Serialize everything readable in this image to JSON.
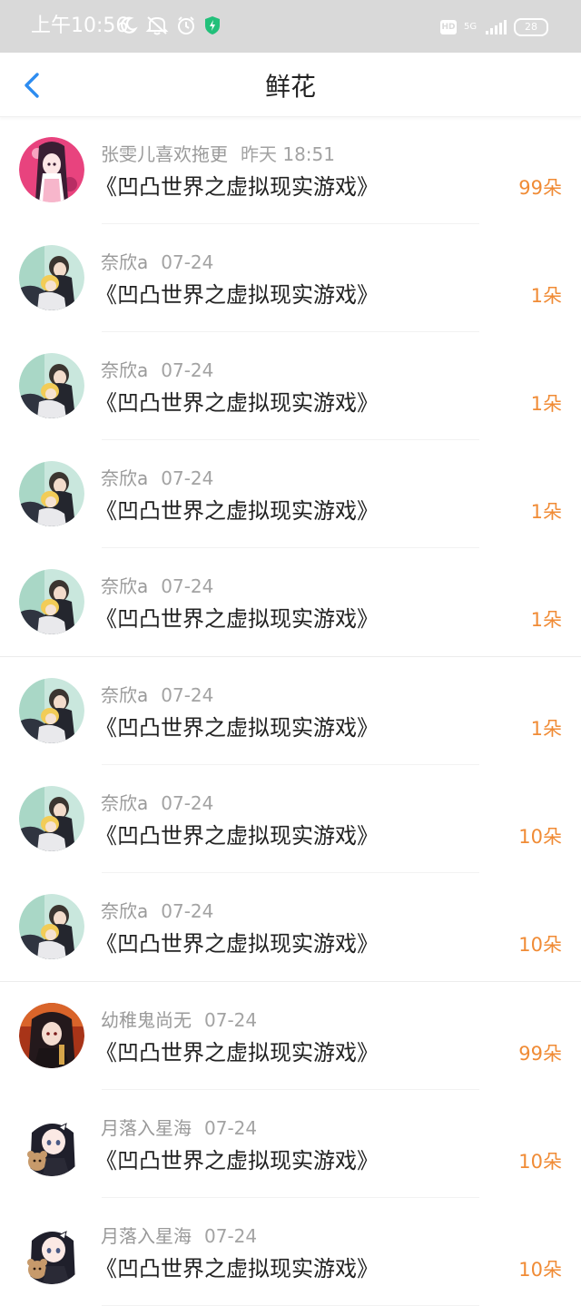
{
  "status_bar": {
    "time": "上午10:56",
    "network": "5G",
    "hd": "HD",
    "battery": "28",
    "colors": {
      "background": "#d9d9d9",
      "foreground": "#ffffff",
      "shield": "#22c07a"
    },
    "icons": [
      "moon-icon",
      "mute-icon",
      "alarm-icon",
      "shield-icon",
      "hd-icon",
      "signal-icon",
      "battery-icon"
    ]
  },
  "nav": {
    "title": "鲜花",
    "back_icon": "chevron-left-icon",
    "colors": {
      "back": "#2d8cf0",
      "title": "#222222"
    }
  },
  "accent_color": "#f08b35",
  "rows": [
    {
      "name": "张雯儿喜欢拖更",
      "date": "昨天 18:51",
      "book": "《凹凸世界之虚拟现实游戏》",
      "count": "99朵",
      "avatar": "avatar-pink-girl"
    },
    {
      "name": "奈欣a",
      "date": "07-24",
      "book": "《凹凸世界之虚拟现实游戏》",
      "count": "1朵",
      "avatar": "avatar-couple"
    },
    {
      "name": "奈欣a",
      "date": "07-24",
      "book": "《凹凸世界之虚拟现实游戏》",
      "count": "1朵",
      "avatar": "avatar-couple"
    },
    {
      "name": "奈欣a",
      "date": "07-24",
      "book": "《凹凸世界之虚拟现实游戏》",
      "count": "1朵",
      "avatar": "avatar-couple"
    },
    {
      "name": "奈欣a",
      "date": "07-24",
      "book": "《凹凸世界之虚拟现实游戏》",
      "count": "1朵",
      "avatar": "avatar-couple"
    },
    {
      "name": "奈欣a",
      "date": "07-24",
      "book": "《凹凸世界之虚拟现实游戏》",
      "count": "1朵",
      "avatar": "avatar-couple"
    },
    {
      "name": "奈欣a",
      "date": "07-24",
      "book": "《凹凸世界之虚拟现实游戏》",
      "count": "10朵",
      "avatar": "avatar-couple"
    },
    {
      "name": "奈欣a",
      "date": "07-24",
      "book": "《凹凸世界之虚拟现实游戏》",
      "count": "10朵",
      "avatar": "avatar-couple"
    },
    {
      "name": "幼稚鬼尚无",
      "date": "07-24",
      "book": "《凹凸世界之虚拟现实游戏》",
      "count": "99朵",
      "avatar": "avatar-dark-girl"
    },
    {
      "name": "月落入星海",
      "date": "07-24",
      "book": "《凹凸世界之虚拟现实游戏》",
      "count": "10朵",
      "avatar": "avatar-bear-girl"
    },
    {
      "name": "月落入星海",
      "date": "07-24",
      "book": "《凹凸世界之虚拟现实游戏》",
      "count": "10朵",
      "avatar": "avatar-bear-girl"
    }
  ]
}
